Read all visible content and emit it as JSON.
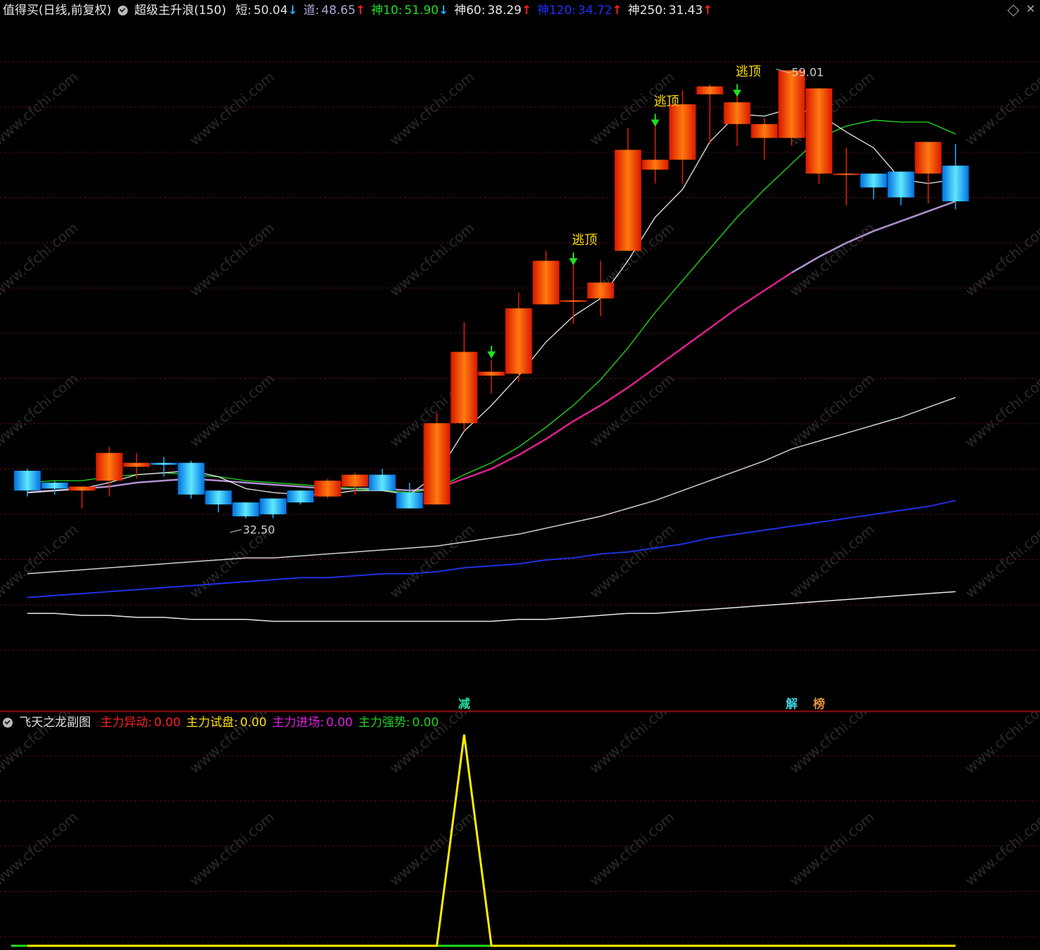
{
  "main_header": {
    "title": "值得买(日线,前复权)",
    "indicator": "超级主升浪(150)",
    "items": [
      {
        "label": "短:",
        "value": "50.04",
        "arrow": "↓",
        "color": "#e0e0e0",
        "arrow_color": "#28a8ff"
      },
      {
        "label": "道:",
        "value": "48.65",
        "arrow": "↑",
        "color": "#b0a8d8",
        "arrow_color": "#ff2020"
      },
      {
        "label": "神10:",
        "value": "51.90",
        "arrow": "↓",
        "color": "#20e020",
        "arrow_color": "#28a8ff"
      },
      {
        "label": "神60:",
        "value": "38.29",
        "arrow": "↑",
        "color": "#e8e8e8",
        "arrow_color": "#ff2020"
      },
      {
        "label": "神120:",
        "value": "34.72",
        "arrow": "↑",
        "color": "#2030ff",
        "arrow_color": "#ff2020"
      },
      {
        "label": "神250:",
        "value": "31.43",
        "arrow": "↑",
        "color": "#e8e8e8",
        "arrow_color": "#ff2020"
      }
    ]
  },
  "sub_header": {
    "title": "飞天之龙副图",
    "items": [
      {
        "label": "主力异动:",
        "value": "0.00",
        "color": "#ff2020"
      },
      {
        "label": "主力试盘:",
        "value": "0.00",
        "color": "#ffe000"
      },
      {
        "label": "主力进场:",
        "value": "0.00",
        "color": "#e020e0"
      },
      {
        "label": "主力强势:",
        "value": "0.00",
        "color": "#20d020"
      }
    ]
  },
  "annotations": {
    "high_label": "59.01",
    "low_label": "32.50",
    "escape_label": "逃顶",
    "signal_reduce": "减",
    "signal_solve": "解",
    "signal_rank": "榜"
  },
  "watermark": "www.cfchi.com",
  "colors": {
    "up_candle": "#ff3a00",
    "down_candle": "#20b0ff",
    "grid": "#7a1010",
    "ma_short": "#e8e8e8",
    "ma_dao": "#b090d0",
    "ma10": "#20e020",
    "ma_mid": "#e0208c",
    "ma60": "#d0d0d0",
    "ma120": "#2030e0",
    "ma250": "#e8e8e8",
    "sub_line": "#ffee00",
    "sub_base": "#20e020"
  },
  "chart_data": {
    "type": "candlestick",
    "price_range": [
      27.5,
      61.5
    ],
    "candles": [
      {
        "o": 38.8,
        "h": 38.9,
        "l": 37.5,
        "c": 37.8
      },
      {
        "o": 38.2,
        "h": 38.3,
        "l": 37.6,
        "c": 37.9
      },
      {
        "o": 37.8,
        "h": 38.0,
        "l": 36.9,
        "c": 38.0
      },
      {
        "o": 38.3,
        "h": 40.0,
        "l": 37.5,
        "c": 39.7
      },
      {
        "o": 39.0,
        "h": 39.7,
        "l": 38.4,
        "c": 39.2
      },
      {
        "o": 39.2,
        "h": 39.5,
        "l": 38.5,
        "c": 39.1
      },
      {
        "o": 39.2,
        "h": 39.3,
        "l": 37.4,
        "c": 37.6
      },
      {
        "o": 37.8,
        "h": 37.6,
        "l": 36.7,
        "c": 37.1
      },
      {
        "o": 37.2,
        "h": 37.2,
        "l": 36.4,
        "c": 36.5
      },
      {
        "o": 37.4,
        "h": 37.4,
        "l": 36.4,
        "c": 36.6
      },
      {
        "o": 37.8,
        "h": 37.8,
        "l": 37.1,
        "c": 37.2
      },
      {
        "o": 37.5,
        "h": 38.4,
        "l": 37.4,
        "c": 38.3
      },
      {
        "o": 38.0,
        "h": 38.7,
        "l": 37.6,
        "c": 38.6
      },
      {
        "o": 38.6,
        "h": 38.9,
        "l": 37.8,
        "c": 37.8
      },
      {
        "o": 37.7,
        "h": 38.2,
        "l": 36.9,
        "c": 36.9
      },
      {
        "o": 37.1,
        "h": 41.7,
        "l": 37.1,
        "c": 41.2
      },
      {
        "o": 41.2,
        "h": 46.3,
        "l": 40.8,
        "c": 44.8
      },
      {
        "o": 43.6,
        "h": 44.4,
        "l": 42.7,
        "c": 43.8
      },
      {
        "o": 43.7,
        "h": 47.8,
        "l": 43.3,
        "c": 47.0
      },
      {
        "o": 47.2,
        "h": 49.9,
        "l": 47.2,
        "c": 49.4
      },
      {
        "o": 47.4,
        "h": 49.6,
        "l": 46.2,
        "c": 47.4
      },
      {
        "o": 47.5,
        "h": 49.4,
        "l": 46.6,
        "c": 48.3
      },
      {
        "o": 49.9,
        "h": 56.1,
        "l": 49.9,
        "c": 55.0
      },
      {
        "o": 54.0,
        "h": 56.6,
        "l": 53.3,
        "c": 54.5
      },
      {
        "o": 54.5,
        "h": 58.0,
        "l": 53.3,
        "c": 57.3
      },
      {
        "o": 57.8,
        "h": 58.3,
        "l": 55.3,
        "c": 58.2
      },
      {
        "o": 56.3,
        "h": 58.1,
        "l": 55.2,
        "c": 57.4
      },
      {
        "o": 55.6,
        "h": 56.6,
        "l": 54.5,
        "c": 56.3
      },
      {
        "o": 55.6,
        "h": 59.01,
        "l": 55.2,
        "c": 59.01
      },
      {
        "o": 53.8,
        "h": 55.8,
        "l": 53.3,
        "c": 58.1
      },
      {
        "o": 53.8,
        "h": 55.1,
        "l": 52.2,
        "c": 53.8
      },
      {
        "o": 53.8,
        "h": 53.8,
        "l": 52.5,
        "c": 53.1
      },
      {
        "o": 53.9,
        "h": 53.9,
        "l": 52.2,
        "c": 52.6
      },
      {
        "o": 53.8,
        "h": 54.4,
        "l": 52.3,
        "c": 55.4
      },
      {
        "o": 54.2,
        "h": 55.3,
        "l": 52.0,
        "c": 52.4
      }
    ],
    "ma_short": [
      37.7,
      37.8,
      37.9,
      38.2,
      38.6,
      38.7,
      38.8,
      38.5,
      37.9,
      37.7,
      37.6,
      37.6,
      37.8,
      37.8,
      37.6,
      38.6,
      40.8,
      42.1,
      43.6,
      45.3,
      46.6,
      47.5,
      49.4,
      51.6,
      53.0,
      55.4,
      56.8,
      56.7,
      57.1,
      56.8,
      55.9,
      55.1,
      53.5,
      53.3,
      53.5
    ],
    "ma_dao": [
      37.7,
      37.8,
      37.9,
      38.0,
      38.2,
      38.3,
      38.4,
      38.3,
      38.2,
      38.1,
      38.0,
      37.9,
      37.9,
      37.9,
      37.8,
      37.9,
      38.4,
      38.9,
      39.6,
      40.4,
      41.3,
      42.1,
      43.0,
      44.0,
      45.0,
      46.0,
      47.0,
      47.9,
      48.8,
      49.6,
      50.3,
      50.9,
      51.4,
      51.9,
      52.4
    ],
    "ma10": [
      38.2,
      38.3,
      38.3,
      38.5,
      38.6,
      38.7,
      38.6,
      38.5,
      38.3,
      38.2,
      38.1,
      38.0,
      37.9,
      37.8,
      37.7,
      37.9,
      38.6,
      39.2,
      40.0,
      41.0,
      42.1,
      43.4,
      45.0,
      46.8,
      48.4,
      50.0,
      51.6,
      53.0,
      54.3,
      55.6,
      56.2,
      56.5,
      56.4,
      56.4,
      55.8
    ],
    "ma60": [
      33.6,
      33.7,
      33.8,
      33.9,
      34.0,
      34.1,
      34.2,
      34.3,
      34.4,
      34.4,
      34.5,
      34.6,
      34.7,
      34.8,
      34.9,
      35.0,
      35.2,
      35.4,
      35.6,
      35.9,
      36.2,
      36.5,
      36.9,
      37.3,
      37.8,
      38.3,
      38.8,
      39.3,
      39.9,
      40.3,
      40.7,
      41.1,
      41.5,
      42.0,
      42.5
    ],
    "ma120": [
      32.4,
      32.5,
      32.6,
      32.7,
      32.8,
      32.9,
      33.0,
      33.1,
      33.2,
      33.3,
      33.4,
      33.4,
      33.5,
      33.6,
      33.6,
      33.7,
      33.9,
      34.0,
      34.1,
      34.3,
      34.4,
      34.6,
      34.7,
      34.9,
      35.1,
      35.4,
      35.6,
      35.8,
      36.0,
      36.2,
      36.4,
      36.6,
      36.8,
      37.0,
      37.3
    ],
    "ma250": [
      31.6,
      31.6,
      31.5,
      31.5,
      31.4,
      31.4,
      31.3,
      31.3,
      31.3,
      31.2,
      31.2,
      31.2,
      31.2,
      31.2,
      31.2,
      31.2,
      31.2,
      31.2,
      31.3,
      31.3,
      31.4,
      31.5,
      31.6,
      31.6,
      31.7,
      31.8,
      31.9,
      32.0,
      32.1,
      32.2,
      32.3,
      32.4,
      32.5,
      32.6,
      32.7
    ],
    "escape_top_indices": [
      20,
      23,
      26
    ],
    "buy_arrow_indices": [
      17
    ],
    "reduce_index": 16,
    "solve_index": 28,
    "rank_index": 29,
    "sub_series": [
      0,
      0,
      0,
      0,
      0,
      0,
      0,
      0,
      0,
      0,
      0,
      0,
      0,
      0,
      0,
      0,
      1,
      0,
      0,
      0,
      0,
      0,
      0,
      0,
      0,
      0,
      0,
      0,
      0,
      0,
      0,
      0,
      0,
      0,
      0
    ]
  }
}
